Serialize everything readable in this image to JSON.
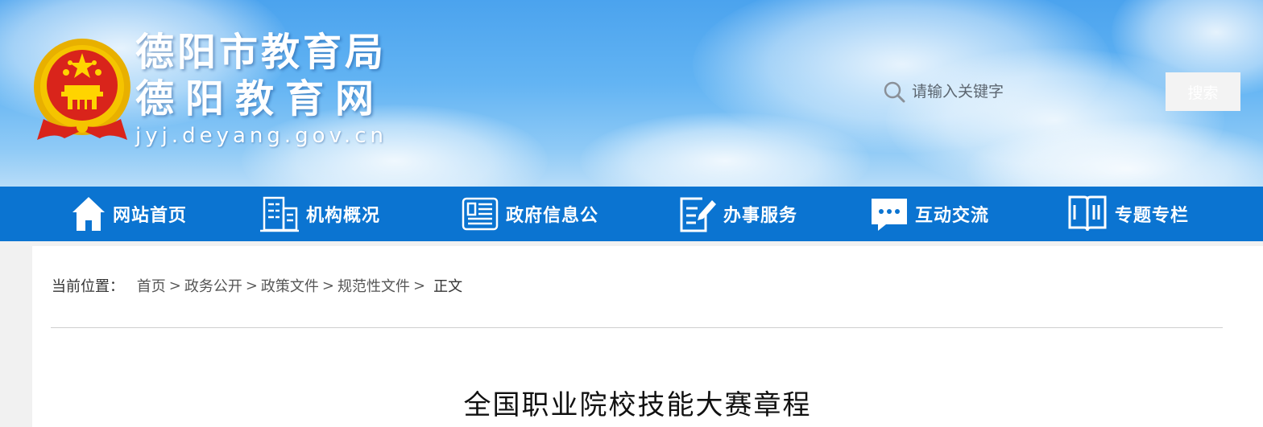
{
  "header": {
    "title_line1": "德阳市教育局",
    "title_line2": "德阳教育网",
    "domain": "jyj.deyang.gov.cn",
    "emblem_icon": "national-emblem-icon"
  },
  "search": {
    "placeholder": "请输入关键字",
    "value": "",
    "button_label": "搜索",
    "icon": "search-icon"
  },
  "nav": {
    "items": [
      {
        "label": "网站首页",
        "icon": "home-icon"
      },
      {
        "label": "机构概况",
        "icon": "building-icon"
      },
      {
        "label": "政府信息公",
        "icon": "newspaper-icon"
      },
      {
        "label": "办事服务",
        "icon": "document-edit-icon"
      },
      {
        "label": "互动交流",
        "icon": "chat-bubble-icon"
      },
      {
        "label": "专题专栏",
        "icon": "open-book-icon"
      }
    ]
  },
  "breadcrumb": {
    "prefix": "当前位置：",
    "links": [
      "首页",
      "政务公开",
      "政策文件",
      "规范性文件"
    ],
    "separator": ">",
    "current": "正文"
  },
  "article": {
    "title": "全国职业院校技能大赛章程"
  },
  "colors": {
    "nav_bg": "#0b74d1",
    "banner_top": "#4ba3ee",
    "page_bg": "#f1f1f1"
  }
}
